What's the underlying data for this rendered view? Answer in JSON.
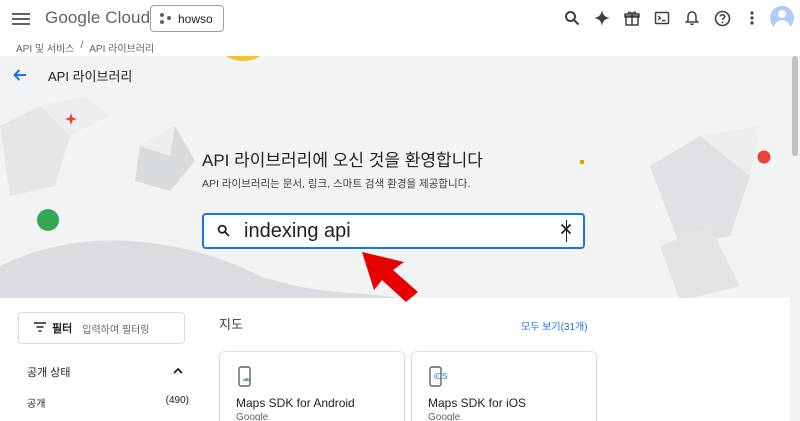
{
  "header": {
    "logo": {
      "google": "Google",
      "cloud": "Cloud"
    },
    "project_label": "howso",
    "icons": [
      "search-icon",
      "gemini-sparkle-icon",
      "gift-icon",
      "cloud-shell-icon",
      "bell-icon",
      "help-icon",
      "more-vert-icon",
      "avatar"
    ]
  },
  "breadcrumb": {
    "items": [
      "API 및 서비스",
      "API 라이브러리"
    ],
    "separator": "/"
  },
  "hero": {
    "page_title": "API 라이브러리",
    "welcome": "API 라이브러리에 오신 것을 환영합니다",
    "subtitle": "API 라이브러리는 문서, 링크, 스마트 검색 환경을 제공합니다.",
    "search_value": "indexing api"
  },
  "filter": {
    "label": "필터",
    "placeholder": "입력하여 필터링",
    "section_title": "공개 상태",
    "facets": [
      {
        "label": "공개",
        "count": "(490)"
      }
    ]
  },
  "maps": {
    "title": "지도",
    "view_all": "모두 보기(31개)",
    "cards": [
      {
        "title": "Maps SDK for Android",
        "provider": "Google",
        "icon": "android-phone-icon"
      },
      {
        "title": "Maps SDK for iOS",
        "provider": "Google",
        "icon": "ios-phone-icon"
      }
    ]
  },
  "colors": {
    "accent": "#1a73e8",
    "hero_bg": "#f1f3f4",
    "arrow": "#ea0000"
  }
}
